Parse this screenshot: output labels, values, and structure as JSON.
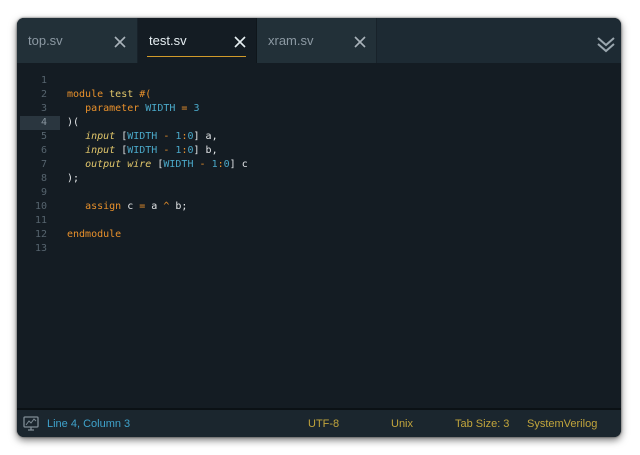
{
  "tabs": [
    {
      "label": "top.sv",
      "active": false
    },
    {
      "label": "test.sv",
      "active": true
    },
    {
      "label": "xram.sv",
      "active": false
    }
  ],
  "editor": {
    "current_line": 4,
    "lines": [
      {
        "number": "1",
        "tokens": []
      },
      {
        "number": "2",
        "tokens": [
          {
            "t": "kw",
            "v": "module"
          },
          {
            "t": "pl",
            "v": " "
          },
          {
            "t": "cls",
            "v": "test"
          },
          {
            "t": "pl",
            "v": " "
          },
          {
            "t": "kw",
            "v": "#("
          }
        ]
      },
      {
        "number": "3",
        "tokens": [
          {
            "t": "pl",
            "v": "   "
          },
          {
            "t": "kw",
            "v": "parameter"
          },
          {
            "t": "pl",
            "v": " "
          },
          {
            "t": "id",
            "v": "WIDTH"
          },
          {
            "t": "pl",
            "v": " "
          },
          {
            "t": "kw",
            "v": "="
          },
          {
            "t": "pl",
            "v": " "
          },
          {
            "t": "num",
            "v": "3"
          }
        ]
      },
      {
        "number": "4",
        "tokens": [
          {
            "t": "pl",
            "v": ")("
          }
        ]
      },
      {
        "number": "5",
        "tokens": [
          {
            "t": "pl",
            "v": "   "
          },
          {
            "t": "ty",
            "v": "input"
          },
          {
            "t": "pl",
            "v": " ["
          },
          {
            "t": "id",
            "v": "WIDTH"
          },
          {
            "t": "pl",
            "v": " "
          },
          {
            "t": "kw",
            "v": "-"
          },
          {
            "t": "pl",
            "v": " "
          },
          {
            "t": "num",
            "v": "1"
          },
          {
            "t": "kw",
            "v": ":"
          },
          {
            "t": "num",
            "v": "0"
          },
          {
            "t": "pl",
            "v": "] a,"
          }
        ]
      },
      {
        "number": "6",
        "tokens": [
          {
            "t": "pl",
            "v": "   "
          },
          {
            "t": "ty",
            "v": "input"
          },
          {
            "t": "pl",
            "v": " ["
          },
          {
            "t": "id",
            "v": "WIDTH"
          },
          {
            "t": "pl",
            "v": " "
          },
          {
            "t": "kw",
            "v": "-"
          },
          {
            "t": "pl",
            "v": " "
          },
          {
            "t": "num",
            "v": "1"
          },
          {
            "t": "kw",
            "v": ":"
          },
          {
            "t": "num",
            "v": "0"
          },
          {
            "t": "pl",
            "v": "] b,"
          }
        ]
      },
      {
        "number": "7",
        "tokens": [
          {
            "t": "pl",
            "v": "   "
          },
          {
            "t": "ty",
            "v": "output"
          },
          {
            "t": "pl",
            "v": " "
          },
          {
            "t": "ty",
            "v": "wire"
          },
          {
            "t": "pl",
            "v": " ["
          },
          {
            "t": "id",
            "v": "WIDTH"
          },
          {
            "t": "pl",
            "v": " "
          },
          {
            "t": "kw",
            "v": "-"
          },
          {
            "t": "pl",
            "v": " "
          },
          {
            "t": "num",
            "v": "1"
          },
          {
            "t": "kw",
            "v": ":"
          },
          {
            "t": "num",
            "v": "0"
          },
          {
            "t": "pl",
            "v": "] c"
          }
        ]
      },
      {
        "number": "8",
        "tokens": [
          {
            "t": "pl",
            "v": ");"
          }
        ]
      },
      {
        "number": "9",
        "tokens": []
      },
      {
        "number": "10",
        "tokens": [
          {
            "t": "pl",
            "v": "   "
          },
          {
            "t": "kw",
            "v": "assign"
          },
          {
            "t": "pl",
            "v": " c "
          },
          {
            "t": "kw",
            "v": "="
          },
          {
            "t": "pl",
            "v": " a "
          },
          {
            "t": "kw",
            "v": "^"
          },
          {
            "t": "pl",
            "v": " b;"
          }
        ]
      },
      {
        "number": "11",
        "tokens": []
      },
      {
        "number": "12",
        "tokens": [
          {
            "t": "kw",
            "v": "endmodule"
          }
        ]
      },
      {
        "number": "13",
        "tokens": []
      }
    ]
  },
  "status": {
    "cursor_position": "Line 4, Column 3",
    "encoding": "UTF-8",
    "line_endings": "Unix",
    "tab_size": "Tab Size: 3",
    "language": "SystemVerilog"
  },
  "icons": {
    "tab_close": "close-icon",
    "overflow": "double-chevron-down-icon",
    "status": "monitor-icon"
  },
  "colors": {
    "background": "#141c23",
    "tabbar": "#1d2a33",
    "accent": "#d19a2a",
    "keyword": "#e8902b",
    "identifier": "#4aa8c8",
    "type": "#e2c76b",
    "status_text": "#c2a53c",
    "status_cursor": "#3fa3cc"
  }
}
